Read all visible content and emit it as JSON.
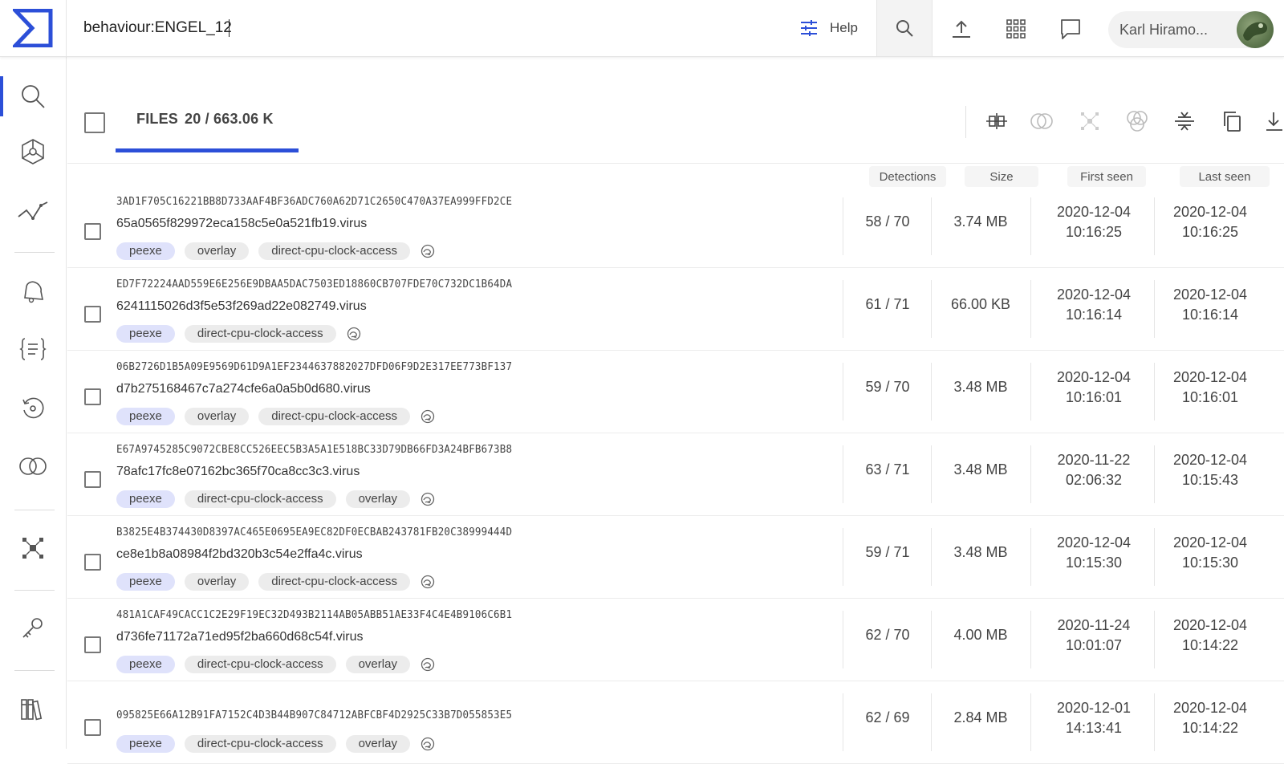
{
  "search": {
    "value": "behaviour:ENGEL_12"
  },
  "topbar": {
    "help_label": "Help",
    "user_name": "Karl Hiramo..."
  },
  "header": {
    "files_label": "FILES",
    "files_count": "20 / 663.06 K"
  },
  "columns": {
    "detections": "Detections",
    "size": "Size",
    "first_seen": "First seen",
    "last_seen": "Last seen"
  },
  "rows": [
    {
      "sha": "3AD1F705C16221BB8D733AAF4BF36ADC760A62D71C2650C470A37EA999FFD2CE",
      "name": "65a0565f829972eca158c5e0a521fb19.virus",
      "tags": [
        "peexe",
        "overlay",
        "direct-cpu-clock-access"
      ],
      "detections": "58 / 70",
      "size": "3.74 MB",
      "first_date": "2020-12-04",
      "first_time": "10:16:25",
      "last_date": "2020-12-04",
      "last_time": "10:16:25"
    },
    {
      "sha": "ED7F72224AAD559E6E256E9DBAA5DAC7503ED18860CB707FDE70C732DC1B64DA",
      "name": "6241115026d3f5e53f269ad22e082749.virus",
      "tags": [
        "peexe",
        "direct-cpu-clock-access"
      ],
      "detections": "61 / 71",
      "size": "66.00 KB",
      "first_date": "2020-12-04",
      "first_time": "10:16:14",
      "last_date": "2020-12-04",
      "last_time": "10:16:14"
    },
    {
      "sha": "06B2726D1B5A09E9569D61D9A1EF2344637882027DFD06F9D2E317EE773BF137",
      "name": "d7b275168467c7a274cfe6a0a5b0d680.virus",
      "tags": [
        "peexe",
        "overlay",
        "direct-cpu-clock-access"
      ],
      "detections": "59 / 70",
      "size": "3.48 MB",
      "first_date": "2020-12-04",
      "first_time": "10:16:01",
      "last_date": "2020-12-04",
      "last_time": "10:16:01"
    },
    {
      "sha": "E67A9745285C9072CBE8CC526EEC5B3A5A1E518BC33D79DB66FD3A24BFB673B8",
      "name": "78afc17fc8e07162bc365f70ca8cc3c3.virus",
      "tags": [
        "peexe",
        "direct-cpu-clock-access",
        "overlay"
      ],
      "detections": "63 / 71",
      "size": "3.48 MB",
      "first_date": "2020-11-22",
      "first_time": "02:06:32",
      "last_date": "2020-12-04",
      "last_time": "10:15:43"
    },
    {
      "sha": "B3825E4B374430D8397AC465E0695EA9EC82DF0ECBAB243781FB20C38999444D",
      "name": "ce8e1b8a08984f2bd320b3c54e2ffa4c.virus",
      "tags": [
        "peexe",
        "overlay",
        "direct-cpu-clock-access"
      ],
      "detections": "59 / 71",
      "size": "3.48 MB",
      "first_date": "2020-12-04",
      "first_time": "10:15:30",
      "last_date": "2020-12-04",
      "last_time": "10:15:30"
    },
    {
      "sha": "481A1CAF49CACC1C2E29F19EC32D493B2114AB05ABB51AE33F4C4E4B9106C6B1",
      "name": "d736fe71172a71ed95f2ba660d68c54f.virus",
      "tags": [
        "peexe",
        "direct-cpu-clock-access",
        "overlay"
      ],
      "detections": "62 / 70",
      "size": "4.00 MB",
      "first_date": "2020-11-24",
      "first_time": "10:01:07",
      "last_date": "2020-12-04",
      "last_time": "10:14:22"
    },
    {
      "sha": "095825E66A12B91FA7152C4D3B44B907C84712ABFCBF4D2925C33B7D055853E5",
      "name": "",
      "tags": [
        "peexe",
        "direct-cpu-clock-access",
        "overlay"
      ],
      "detections": "62 / 69",
      "size": "2.84 MB",
      "first_date": "2020-12-01",
      "first_time": "14:13:41",
      "last_date": "2020-12-04",
      "last_time": "10:14:22"
    }
  ],
  "colors": {
    "accent": "#2c4fd8",
    "peexe_tag": "#dfe2fb",
    "tag": "#ececec"
  }
}
